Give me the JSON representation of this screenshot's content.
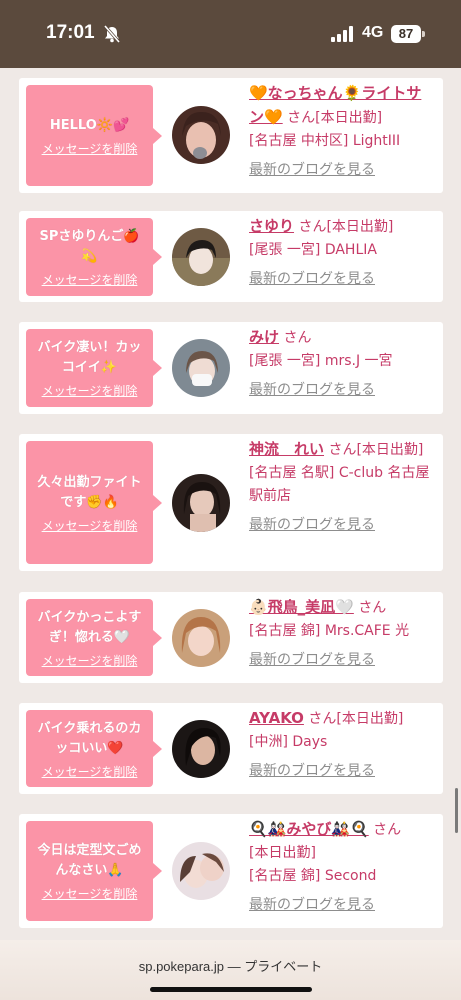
{
  "status_bar": {
    "time": "17:01",
    "network": "4G",
    "battery": "87"
  },
  "cards": [
    {
      "message": "HELLO🔆💕",
      "delete_label": "メッセージを削除",
      "name": "🧡なっちゃん🌻ライトサン🧡",
      "suffix": "さん[本日出勤]",
      "shop": "[名古屋 中村区] LightIII",
      "blog_label": "最新のブログを見る",
      "avatar": "avatar-photo-1"
    },
    {
      "message": "SPさゆりんご🍎💫",
      "delete_label": "メッセージを削除",
      "name": "さゆり",
      "suffix": "さん[本日出勤]",
      "shop": "[尾張 一宮] DAHLIA",
      "blog_label": "最新のブログを見る",
      "avatar": "avatar-photo-2"
    },
    {
      "message": "バイク凄い！カッコイイ✨",
      "delete_label": "メッセージを削除",
      "name": "みけ",
      "suffix": "さん",
      "shop": "[尾張 一宮] mrs.J 一宮",
      "blog_label": "最新のブログを見る",
      "avatar": "avatar-photo-3"
    },
    {
      "message": "久々出勤ファイトです✊🔥",
      "delete_label": "メッセージを削除",
      "name": "神流　れい",
      "suffix": "さん[本日出勤]",
      "shop": "[名古屋 名駅] C-club 名古屋駅前店",
      "blog_label": "最新のブログを見る",
      "avatar": "avatar-photo-4"
    },
    {
      "message": "バイクかっこよすぎ！惚れる🤍",
      "delete_label": "メッセージを削除",
      "name": "👶🏻飛鳥_美凪🤍",
      "suffix": "さん",
      "shop": "[名古屋 錦] Mrs.CAFE 光",
      "blog_label": "最新のブログを見る",
      "avatar": "avatar-photo-5"
    },
    {
      "message": "バイク乗れるのカッコいい❤️",
      "delete_label": "メッセージを削除",
      "name": "AYAKO",
      "suffix": "さん[本日出勤]",
      "shop": "[中洲] Days",
      "blog_label": "最新のブログを見る",
      "avatar": "avatar-photo-6"
    },
    {
      "message": "今日は定型文ごめんなさい🙏",
      "delete_label": "メッセージを削除",
      "name": "🍳🎎みやび🎎🍳",
      "suffix": "さん",
      "shop_line1": "[本日出勤]",
      "shop": "[名古屋 錦] Second",
      "blog_label": "最新のブログを見る",
      "avatar": "avatar-photo-7"
    }
  ],
  "browser": {
    "url": "sp.pokepara.jp",
    "mode": "— プライベート"
  },
  "colors": {
    "accent": "#fb94a7",
    "name": "#c63b67",
    "status_bar": "#5b4a3d"
  }
}
